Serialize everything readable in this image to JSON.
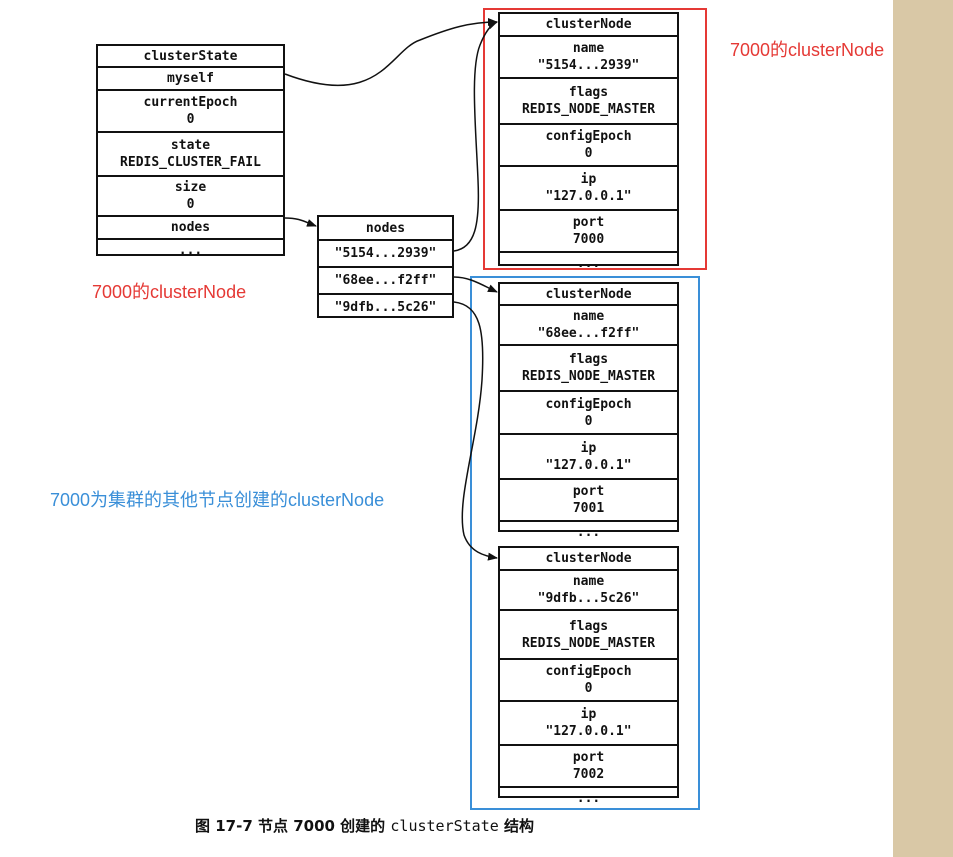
{
  "cluster_state": {
    "title": "clusterState",
    "rows": [
      {
        "line1": "myself",
        "line2": ""
      },
      {
        "line1": "currentEpoch",
        "line2": "0"
      },
      {
        "line1": "state",
        "line2": "REDIS_CLUSTER_FAIL"
      },
      {
        "line1": "size",
        "line2": "0"
      },
      {
        "line1": "nodes",
        "line2": ""
      },
      {
        "line1": "...",
        "line2": ""
      }
    ]
  },
  "nodes_dict": {
    "title": "nodes",
    "entries": [
      "\"5154...2939\"",
      "\"68ee...f2ff\"",
      "\"9dfb...5c26\""
    ]
  },
  "cluster_nodes": [
    {
      "title": "clusterNode",
      "name_label": "name",
      "name": "\"5154...2939\"",
      "flags_label": "flags",
      "flags": "REDIS_NODE_MASTER",
      "epoch_label": "configEpoch",
      "epoch": "0",
      "ip_label": "ip",
      "ip": "\"127.0.0.1\"",
      "port_label": "port",
      "port": "7000",
      "more": "..."
    },
    {
      "title": "clusterNode",
      "name_label": "name",
      "name": "\"68ee...f2ff\"",
      "flags_label": "flags",
      "flags": "REDIS_NODE_MASTER",
      "epoch_label": "configEpoch",
      "epoch": "0",
      "ip_label": "ip",
      "ip": "\"127.0.0.1\"",
      "port_label": "port",
      "port": "7001",
      "more": "..."
    },
    {
      "title": "clusterNode",
      "name_label": "name",
      "name": "\"9dfb...5c26\"",
      "flags_label": "flags",
      "flags": "REDIS_NODE_MASTER",
      "epoch_label": "configEpoch",
      "epoch": "0",
      "ip_label": "ip",
      "ip": "\"127.0.0.1\"",
      "port_label": "port",
      "port": "7002",
      "more": "..."
    }
  ],
  "annotations": {
    "top_right": "7000的clusterNode",
    "left": "7000的clusterNode",
    "blue": "7000为集群的其他节点创建的clusterNode",
    "red_color": "#e53935",
    "blue_color": "#3a8fd8"
  },
  "caption": {
    "prefix": "图 17-7    节点 7000 创建的 ",
    "mono": "clusterState",
    "suffix": " 结构"
  }
}
